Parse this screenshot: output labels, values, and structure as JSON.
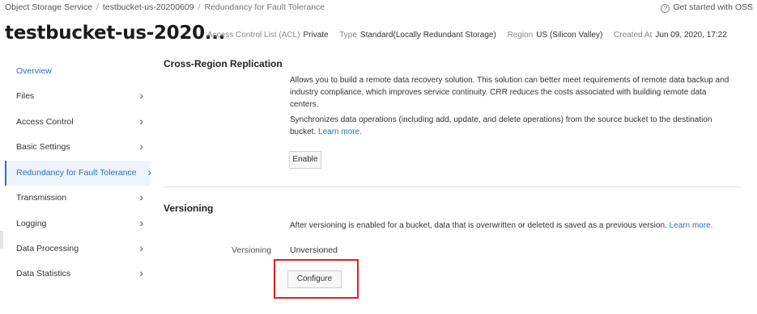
{
  "breadcrumb": {
    "items": [
      "Object Storage Service",
      "testbucket-us-20200609",
      "Redundancy for Fault Tolerance"
    ],
    "separator": "/"
  },
  "help": {
    "label": "Get started with OSS",
    "icon": "?"
  },
  "bucket": {
    "title": "testbucket-us-2020...",
    "meta": [
      {
        "key": "Access Control List (ACL)",
        "value": "Private"
      },
      {
        "key": "Type",
        "value": "Standard(Locally Redundant Storage)"
      },
      {
        "key": "Region",
        "value": "US (Silicon Valley)"
      },
      {
        "key": "Created At",
        "value": "Jun 09, 2020, 17:22"
      }
    ]
  },
  "sidebar": {
    "items": [
      {
        "label": "Overview",
        "chevron": ""
      },
      {
        "label": "Files",
        "chevron": "›"
      },
      {
        "label": "Access Control",
        "chevron": "›"
      },
      {
        "label": "Basic Settings",
        "chevron": "›"
      },
      {
        "label": "Redundancy for Fault Tolerance",
        "chevron": "›"
      },
      {
        "label": "Transmission",
        "chevron": "›"
      },
      {
        "label": "Logging",
        "chevron": "›"
      },
      {
        "label": "Data Processing",
        "chevron": "›"
      },
      {
        "label": "Data Statistics",
        "chevron": "›"
      }
    ],
    "active_index": 4
  },
  "crr": {
    "title": "Cross-Region Replication",
    "desc1": "Allows you to build a remote data recovery solution. This solution can better meet requirements of remote data backup and industry compliance, which improves service continuity. CRR reduces the costs associated with building remote data centers.",
    "desc2": "Synchronizes data operations (including add, update, and delete operations) from the source bucket to the destination bucket.",
    "learn_more": "Learn more.",
    "enable_button": "Enable"
  },
  "versioning": {
    "title": "Versioning",
    "desc": "After versioning is enabled for a bucket, data that is overwritten or deleted is saved as a previous version.",
    "learn_more": "Learn more.",
    "field_label": "Versioning",
    "field_value": "Unversioned",
    "configure_button": "Configure"
  },
  "colors": {
    "accent": "#2b6fc6",
    "highlight_box": "#e02020",
    "active_bg": "#eef4fc"
  }
}
